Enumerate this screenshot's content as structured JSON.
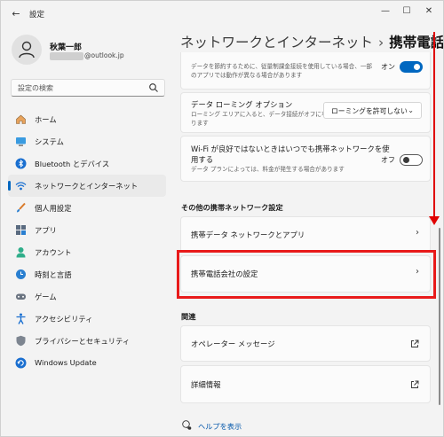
{
  "window": {
    "title": "設定"
  },
  "profile": {
    "name": "秋葉一郎",
    "email_domain": "@outlook.jp"
  },
  "search": {
    "placeholder": "設定の検索"
  },
  "nav": {
    "items": [
      {
        "label": "ホーム",
        "icon": "home-icon"
      },
      {
        "label": "システム",
        "icon": "monitor-icon"
      },
      {
        "label": "Bluetooth とデバイス",
        "icon": "bluetooth-icon"
      },
      {
        "label": "ネットワークとインターネット",
        "icon": "wifi-icon",
        "selected": true
      },
      {
        "label": "個人用設定",
        "icon": "brush-icon"
      },
      {
        "label": "アプリ",
        "icon": "apps-icon"
      },
      {
        "label": "アカウント",
        "icon": "account-icon"
      },
      {
        "label": "時刻と言語",
        "icon": "clock-globe-icon"
      },
      {
        "label": "ゲーム",
        "icon": "gamepad-icon"
      },
      {
        "label": "アクセシビリティ",
        "icon": "accessibility-icon"
      },
      {
        "label": "プライバシーとセキュリティ",
        "icon": "shield-icon"
      },
      {
        "label": "Windows Update",
        "icon": "update-icon"
      }
    ]
  },
  "header": {
    "parent": "ネットワークとインターネット",
    "separator": "›",
    "current": "携帯電話"
  },
  "settings": {
    "data_saver": {
      "desc_line1": "データを節約するために、従量制課金接続を使用している場合、一部",
      "desc_line2": "のアプリでは動作が異なる場合があります",
      "state": "オン"
    },
    "roaming": {
      "title": "データ ローミング オプション",
      "desc_line1": "ローミング エリアに入ると、データ接続がオフにな",
      "desc_line2": "ります",
      "value": "ローミングを許可しない"
    },
    "wifi_fallback": {
      "title_line1": "Wi-Fi が良好ではないときはいつでも携帯ネットワークを使",
      "title_line2": "用する",
      "desc": "データ プランによっては、料金が発生する場合があります",
      "state": "オフ"
    }
  },
  "other_section": {
    "heading": "その他の携帯ネットワーク設定",
    "items": [
      {
        "label": "携帯データ ネットワークとアプリ"
      },
      {
        "label": "携帯電話会社の設定"
      }
    ]
  },
  "related_section": {
    "heading": "関連",
    "items": [
      {
        "label": "オペレーター メッセージ"
      },
      {
        "label": "詳細情報"
      }
    ]
  },
  "help": {
    "label": "ヘルプを表示"
  },
  "colors": {
    "accent": "#0067c0",
    "annotation_red": "#e81a1a"
  }
}
